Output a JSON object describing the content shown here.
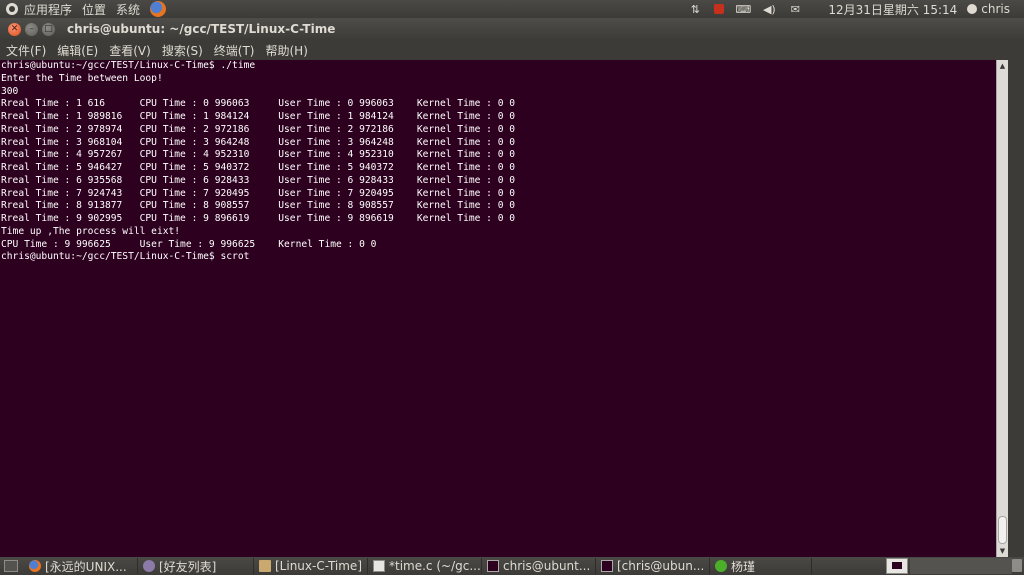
{
  "top_panel": {
    "menus": [
      "应用程序",
      "位置",
      "系统"
    ],
    "clock": "12月31日星期六 15:14",
    "user": "chris",
    "tray_icons": [
      "network-icon",
      "update-icon",
      "keyboard-icon",
      "volume-icon",
      "mail-icon"
    ]
  },
  "window": {
    "title": "chris@ubuntu: ~/gcc/TEST/Linux-C-Time",
    "buttons": [
      "close",
      "minimize",
      "maximize"
    ]
  },
  "menubar": [
    "文件(F)",
    "编辑(E)",
    "查看(V)",
    "搜索(S)",
    "终端(T)",
    "帮助(H)"
  ],
  "terminal": {
    "lines": [
      "chris@ubuntu:~/gcc/TEST/Linux-C-Time$ ./time",
      "Enter the Time between Loop!",
      "300",
      "Rreal Time : 1 616      CPU Time : 0 996063     User Time : 0 996063    Kernel Time : 0 0",
      "Rreal Time : 1 989816   CPU Time : 1 984124     User Time : 1 984124    Kernel Time : 0 0",
      "Rreal Time : 2 978974   CPU Time : 2 972186     User Time : 2 972186    Kernel Time : 0 0",
      "Rreal Time : 3 968104   CPU Time : 3 964248     User Time : 3 964248    Kernel Time : 0 0",
      "Rreal Time : 4 957267   CPU Time : 4 952310     User Time : 4 952310    Kernel Time : 0 0",
      "Rreal Time : 5 946427   CPU Time : 5 940372     User Time : 5 940372    Kernel Time : 0 0",
      "Rreal Time : 6 935568   CPU Time : 6 928433     User Time : 6 928433    Kernel Time : 0 0",
      "Rreal Time : 7 924743   CPU Time : 7 920495     User Time : 7 920495    Kernel Time : 0 0",
      "Rreal Time : 8 913877   CPU Time : 8 908557     User Time : 8 908557    Kernel Time : 0 0",
      "Rreal Time : 9 902995   CPU Time : 9 896619     User Time : 9 896619    Kernel Time : 0 0",
      "Time up ,The process will eixt!",
      "CPU Time : 9 996625     User Time : 9 996625    Kernel Time : 0 0",
      "chris@ubuntu:~/gcc/TEST/Linux-C-Time$ scrot"
    ]
  },
  "taskbar": {
    "tasks": [
      {
        "label": "[永远的UNIX...",
        "icon": "firefox-icon"
      },
      {
        "label": "[好友列表]",
        "icon": "pidgin-icon"
      },
      {
        "label": "[Linux-C-Time]",
        "icon": "folder-icon"
      },
      {
        "label": "*time.c (~/gc...",
        "icon": "text-editor-icon"
      },
      {
        "label": "chris@ubunt...",
        "icon": "terminal-icon"
      },
      {
        "label": "[chris@ubun...",
        "icon": "terminal-icon"
      },
      {
        "label": "杨瑾",
        "icon": "chat-status-icon"
      }
    ]
  }
}
